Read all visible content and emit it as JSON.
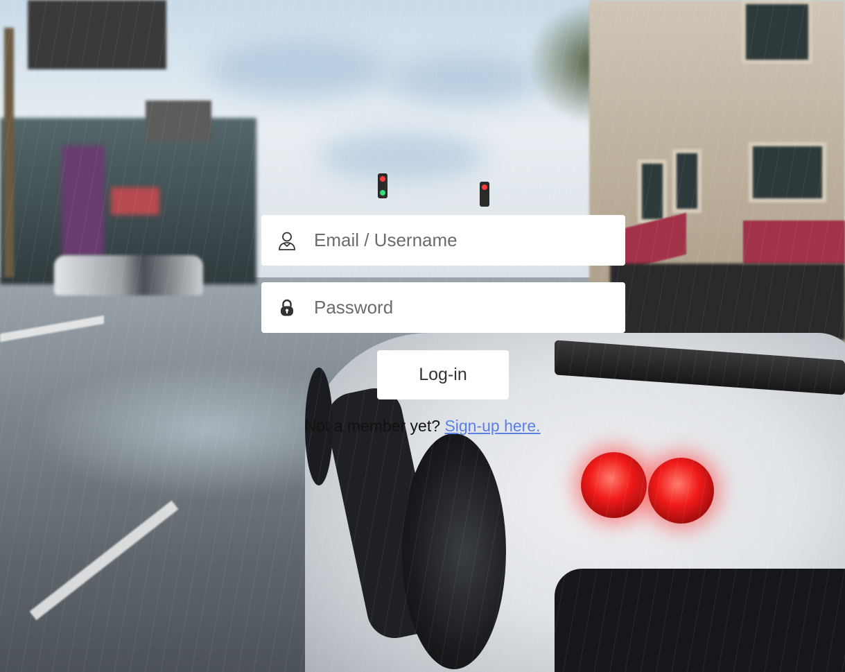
{
  "login_form": {
    "email_placeholder": "Email / Username",
    "email_icon": "user-icon",
    "password_placeholder": "Password",
    "password_icon": "lock-icon",
    "login_button_label": "Log-in",
    "signup_prompt": "Not a member yet?",
    "signup_link_label": "Sign-up here."
  },
  "colors": {
    "field_background": "#ffffff",
    "link_color": "#5b7fe3",
    "text_color": "#111111"
  }
}
